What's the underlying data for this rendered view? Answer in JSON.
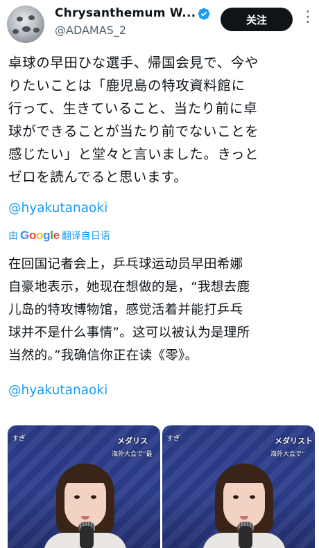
{
  "author": {
    "display_name": "Chrysanthemum W...",
    "handle": "@ADAMAS_2",
    "verified_icon": "verified-badge-icon",
    "follow_label": "关注",
    "more_icon": "more-options-icon"
  },
  "tweet": {
    "text_lines": [
      "卓球の早田ひな選手、帰国会見で、今や",
      "りたいことは「鹿児島の特攻資料館に",
      "行って、生きていること、当たり前に卓",
      "球ができることが当たり前でないことを",
      "感じたい」と堂々と言いました。きっと",
      "ゼロを読んでると思います。"
    ],
    "mention": "@hyakutanaoki"
  },
  "translation": {
    "prefix": "由",
    "provider_letters": [
      "G",
      "o",
      "o",
      "g",
      "l",
      "e"
    ],
    "suffix": "翻译自日语",
    "text_lines": [
      "在回国记者会上，乒乓球运动员早田希娜",
      "自豪地表示，她现在想做的是，“我想去鹿",
      "儿岛的特攻博物馆，感觉活着并能打乒乓",
      "球并不是什么事情”。这可以被认为是理所",
      "当然的。”我确信你正在读《零》。"
    ],
    "mention": "@hyakutanaoki"
  },
  "media": [
    {
      "corner": "すぎ",
      "label": "メダリス",
      "sub": "海外大会で“最"
    },
    {
      "corner": "すぎ",
      "label": "メダリスト",
      "sub": "海外大会で“"
    }
  ],
  "colors": {
    "accent": "#1d9bf0",
    "follow_bg": "#0f1419",
    "media_bg": "#2a3b87"
  }
}
